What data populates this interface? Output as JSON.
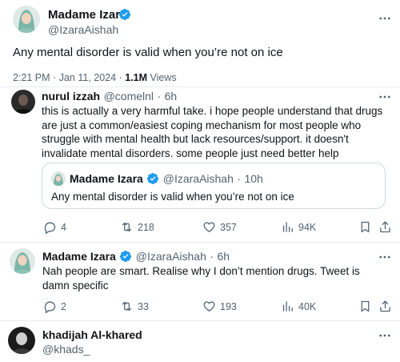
{
  "main_tweet": {
    "name": "Madame Izara",
    "handle": "@IzaraAishah",
    "text": "Any mental disorder is valid when you’re not on ice",
    "time": "2:21 PM",
    "dot": "·",
    "date": "Jan 11, 2024",
    "views_count": "1.1M",
    "views_label": "Views"
  },
  "reply_1": {
    "name": "nurul izzah",
    "handle": "@comelnl",
    "dot": "·",
    "age": "6h",
    "text": "this is actually a very harmful take. i hope people understand that drugs are just a common/easiest coping mechanism for most people who struggle with mental health but lack resources/support. it doesn't invalidate mental disorders. some people just need better help",
    "quote": {
      "name": "Madame Izara",
      "handle": "@IzaraAishah",
      "dot": "·",
      "age": "10h",
      "text": "Any mental disorder is valid when you’re not on ice"
    },
    "stats": {
      "replies": "4",
      "retweets": "218",
      "likes": "357",
      "views": "94K"
    }
  },
  "reply_2": {
    "name": "Madame Izara",
    "handle": "@IzaraAishah",
    "dot": "·",
    "age": "6h",
    "text": "Nah people are smart. Realise why I don’t mention drugs. Tweet is damn specific",
    "stats": {
      "replies": "2",
      "retweets": "33",
      "likes": "193",
      "views": "40K"
    }
  },
  "reply_3": {
    "name": "khadijah Al-khared",
    "handle": "@khads_"
  },
  "colors": {
    "verified": "#1d9bf0",
    "secondary_text": "#536471",
    "primary_text": "#0f1419"
  },
  "icons": [
    "verified-icon",
    "more-icon",
    "reply-icon",
    "retweet-icon",
    "like-icon",
    "views-icon",
    "bookmark-icon",
    "share-icon"
  ]
}
